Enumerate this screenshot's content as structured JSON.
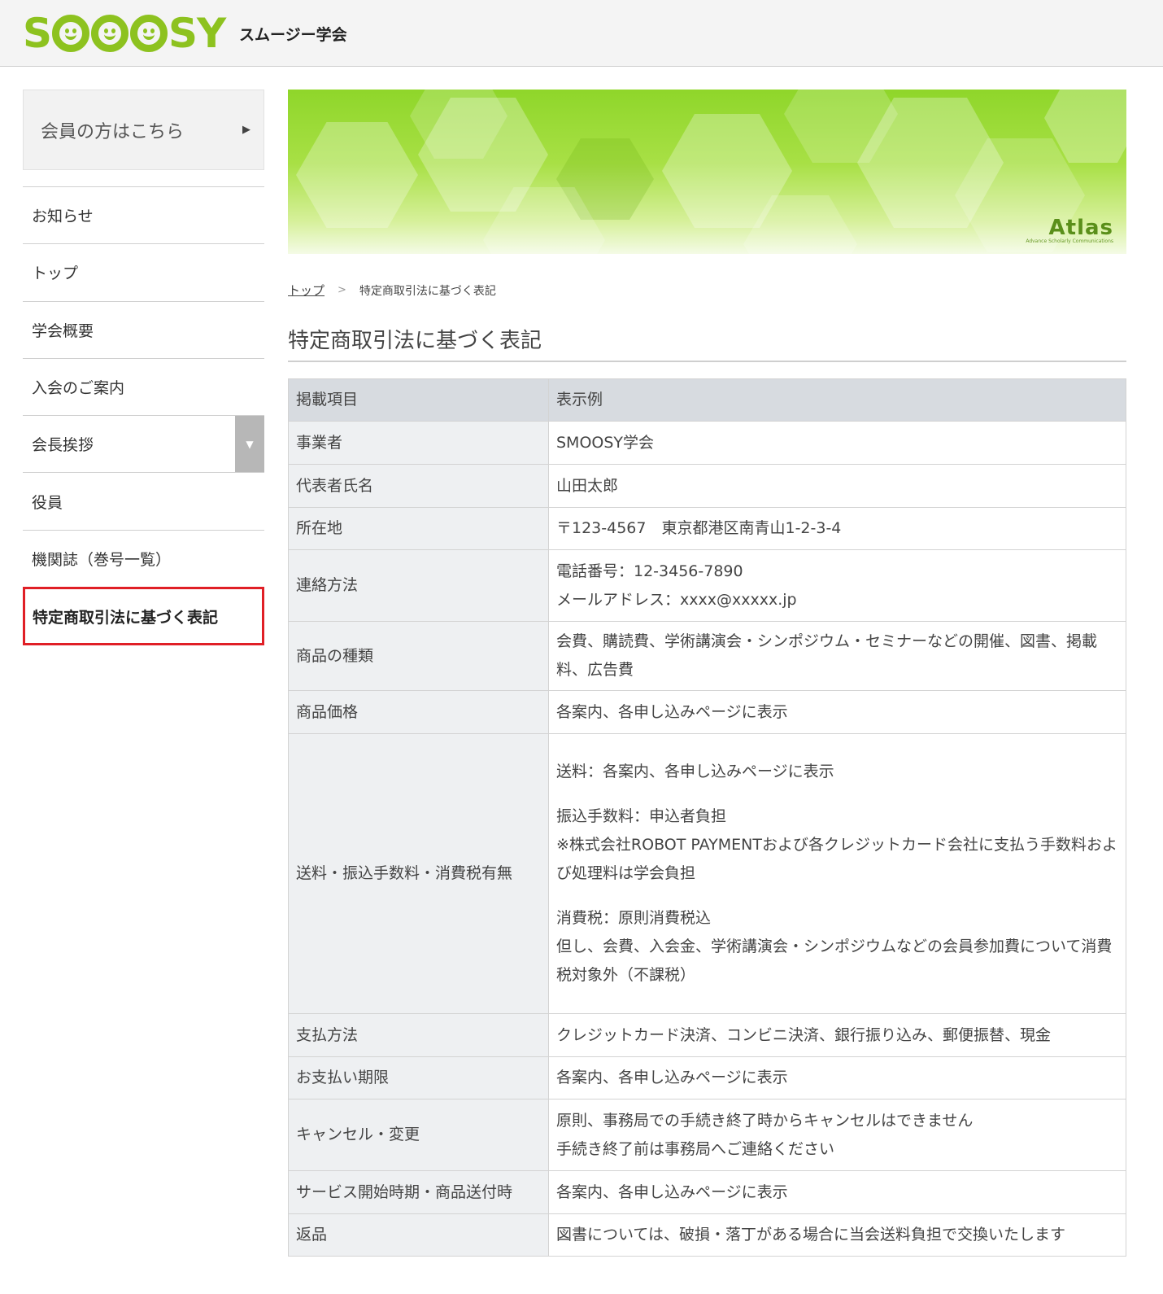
{
  "header": {
    "logo_text_s": "S",
    "logo_text_sy": "SY",
    "site_name": "スムージー学会"
  },
  "sidebar": {
    "member_label": "会員の方はこちら",
    "member_arrow": "▶",
    "items": [
      {
        "label": "お知らせ"
      },
      {
        "label": "トップ"
      },
      {
        "label": "学会概要"
      },
      {
        "label": "入会のご案内"
      },
      {
        "label": "会長挨拶",
        "toggle": "▼"
      },
      {
        "label": "役員"
      },
      {
        "label": "機関誌（巻号一覧）"
      },
      {
        "label": "特定商取引法に基づく表記"
      }
    ]
  },
  "banner": {
    "brand": "Atlas",
    "brand_sub": "Advance Scholarly Communications"
  },
  "breadcrumb": {
    "home": "トップ",
    "sep": ">",
    "current": "特定商取引法に基づく表記"
  },
  "page_title": "特定商取引法に基づく表記",
  "table": {
    "head": {
      "key": "掲載項目",
      "value": "表示例"
    },
    "rows": [
      {
        "key": "事業者",
        "lines": [
          "SMOOSY学会"
        ]
      },
      {
        "key": "代表者氏名",
        "lines": [
          "山田太郎"
        ]
      },
      {
        "key": "所在地",
        "lines": [
          "〒123-4567　東京都港区南青山1-2-3-4"
        ]
      },
      {
        "key": "連絡方法",
        "lines": [
          "電話番号：12-3456-7890",
          "メールアドレス：xxxx@xxxxx.jp"
        ]
      },
      {
        "key": "商品の種類",
        "lines": [
          "会費、購読費、学術講演会・シンポジウム・セミナーなどの開催、図書、掲載料、広告費"
        ]
      },
      {
        "key": "商品価格",
        "lines": [
          "各案内、各申し込みページに表示"
        ]
      },
      {
        "key": "送料・振込手数料・消費税有無",
        "lines": [
          "送料：各案内、各申し込みページに表示",
          "振込手数料：申込者負担",
          "※株式会社ROBOT PAYMENTおよび各クレジットカード会社に支払う手数料および処理料は学会負担",
          "消費税：原則消費税込",
          "但し、会費、入会金、学術講演会・シンポジウムなどの会員参加費について消費税対象外（不課税）"
        ]
      },
      {
        "key": "支払方法",
        "lines": [
          "クレジットカード決済、コンビニ決済、銀行振り込み、郵便振替、現金"
        ]
      },
      {
        "key": "お支払い期限",
        "lines": [
          "各案内、各申し込みページに表示"
        ]
      },
      {
        "key": "キャンセル・変更",
        "lines": [
          "原則、事務局での手続き終了時からキャンセルはできません",
          "手続き終了前は事務局へご連絡ください"
        ]
      },
      {
        "key": "サービス開始時期・商品送付時",
        "lines": [
          "各案内、各申し込みページに表示"
        ]
      },
      {
        "key": "返品",
        "lines": [
          "図書については、破損・落丁がある場合に当会送料負担で交換いたします"
        ]
      }
    ]
  },
  "colors": {
    "brand_green": "#8dc21f",
    "active_border": "#e01f26",
    "table_head_bg": "#d7dbe0",
    "table_key_bg": "#eef0f2"
  }
}
